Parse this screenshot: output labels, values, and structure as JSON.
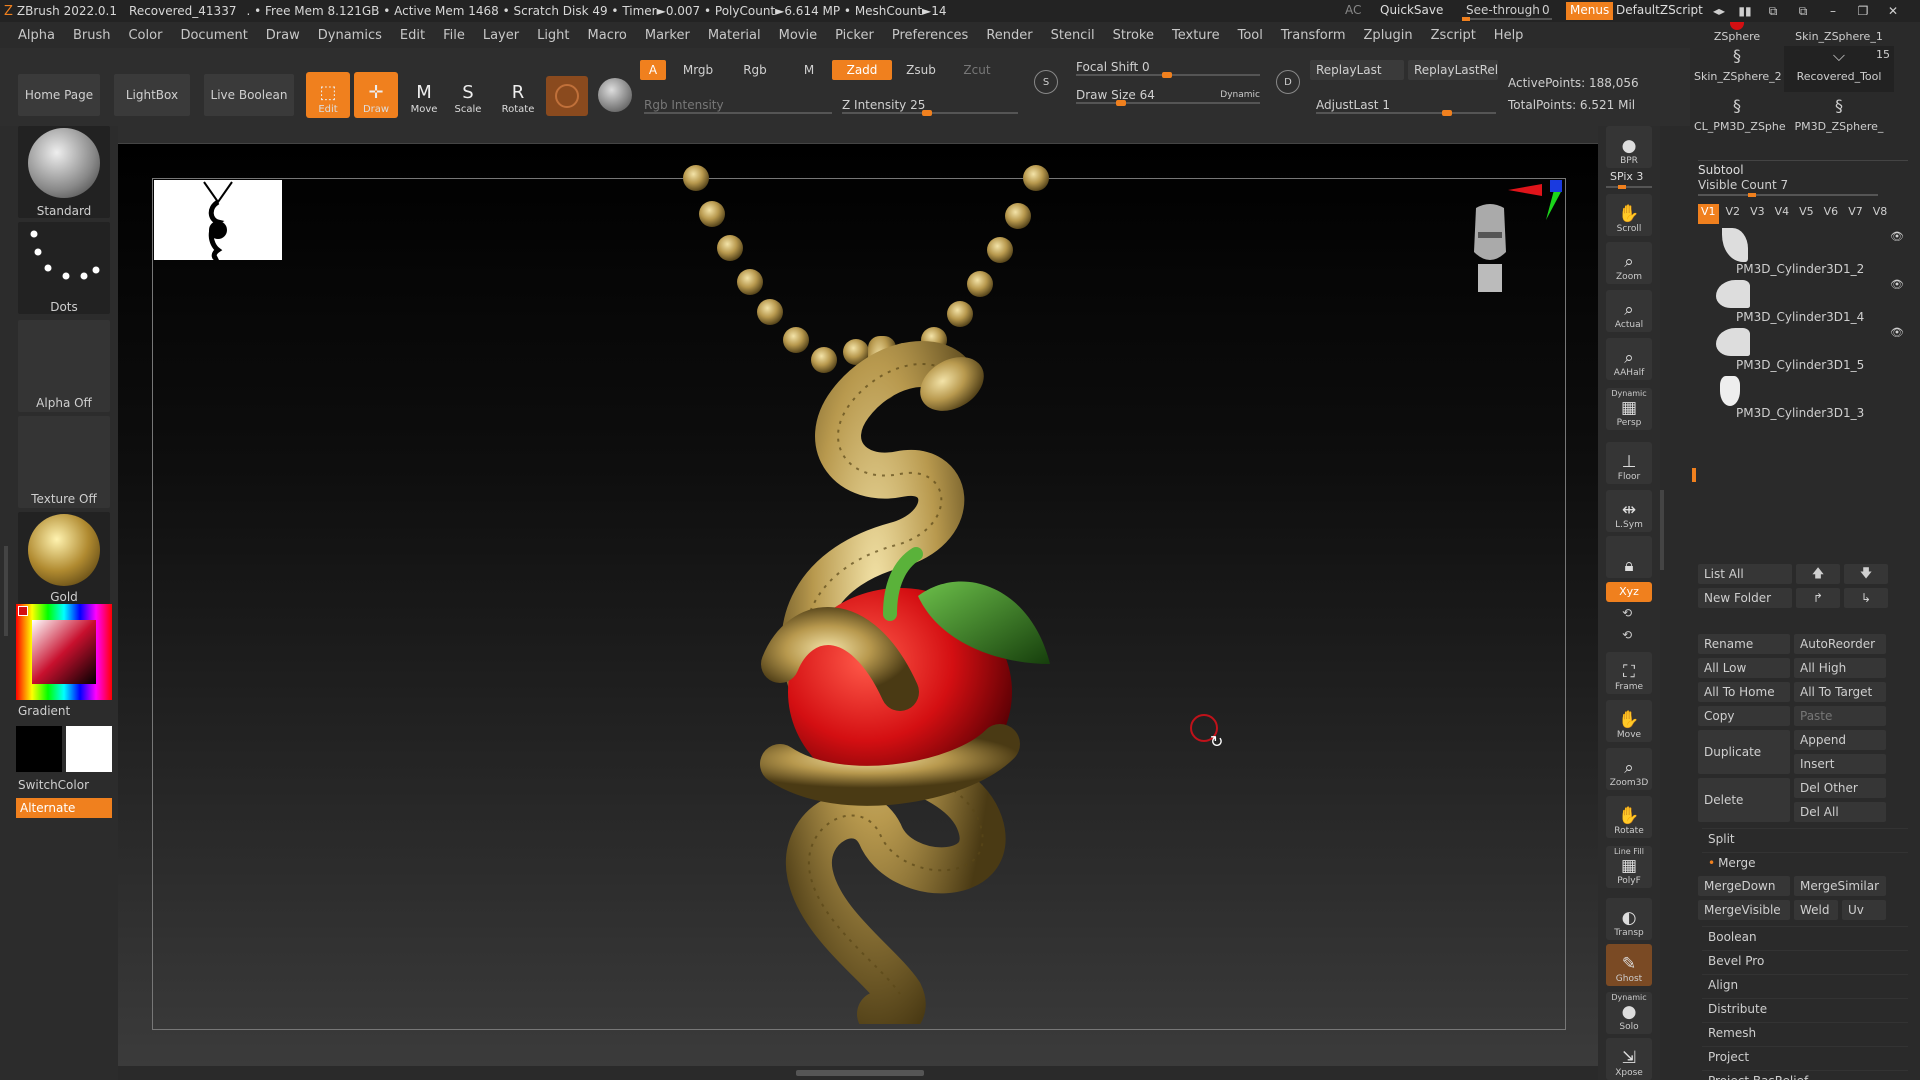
{
  "titlebar": {
    "app": "ZBrush 2022.0.1",
    "file": "Recovered_41337",
    "stats": ". • Free Mem 8.121GB • Active Mem 1468 • Scratch Disk 49 • Timer►0.007 • PolyCount►6.614 MP • MeshCount►14",
    "ac": "AC",
    "quicksave": "QuickSave",
    "seethrough_label": "See-through",
    "seethrough_value": "0",
    "menus": "Menus",
    "zscript": "DefaultZScript"
  },
  "menubar": [
    "Alpha",
    "Brush",
    "Color",
    "Document",
    "Draw",
    "Dynamics",
    "Edit",
    "File",
    "Layer",
    "Light",
    "Macro",
    "Marker",
    "Material",
    "Movie",
    "Picker",
    "Preferences",
    "Render",
    "Stencil",
    "Stroke",
    "Texture",
    "Tool",
    "Transform",
    "Zplugin",
    "Zscript",
    "Help"
  ],
  "toolbar": {
    "home": "Home Page",
    "lightbox": "LightBox",
    "liveboolean": "Live Boolean",
    "edit": "Edit",
    "draw": "Draw",
    "move": "Move",
    "scale": "Scale",
    "rotate": "Rotate",
    "a": "A",
    "mrgb": "Mrgb",
    "rgb": "Rgb",
    "m": "M",
    "zadd": "Zadd",
    "zsub": "Zsub",
    "zcut": "Zcut",
    "rgb_intensity": "Rgb Intensity",
    "z_intensity": "Z Intensity 25",
    "z_intensity_value": 25,
    "focal_shift": "Focal Shift 0",
    "draw_size": "Draw Size 64",
    "dynamic": "Dynamic",
    "replaylast": "ReplayLast",
    "replaylastrel": "ReplayLastRel",
    "adjustlast": "AdjustLast 1",
    "activepoints": "ActivePoints: 188,056",
    "totalpoints": "TotalPoints: 6.521 Mil"
  },
  "leftpanel": {
    "brush": "Standard",
    "stroke": "Dots",
    "alpha": "Alpha Off",
    "texture": "Texture Off",
    "material": "Gold",
    "gradient": "Gradient",
    "switchcolor": "SwitchColor",
    "alternate": "Alternate"
  },
  "rightshelf": [
    "BPR",
    "SPix 3",
    "Scroll",
    "Zoom",
    "Actual",
    "AAHalf",
    "Persp",
    "Floor",
    "L.Sym",
    "Xyz",
    "Frame",
    "Move",
    "Zoom3D",
    "Rotate",
    "PolyF",
    "Transp",
    "Ghost",
    "Solo",
    "Xpose"
  ],
  "rightshelf_extra": {
    "dynamic": "Dynamic",
    "linefill": "Line Fill"
  },
  "tray": {
    "tools": [
      {
        "name": "ZSphere"
      },
      {
        "name": "Skin_ZSphere_1"
      },
      {
        "name": "Skin_ZSphere_2"
      },
      {
        "name": "Recovered_Tool"
      },
      {
        "name": "CL_PM3D_ZSphe"
      },
      {
        "name": "PM3D_ZSphere_"
      }
    ],
    "tool_count": "15",
    "subtool_title": "Subtool",
    "visible_count": "Visible Count 7",
    "versions": [
      "V1",
      "V2",
      "V3",
      "V4",
      "V5",
      "V6",
      "V7",
      "V8"
    ],
    "subtools": [
      "PM3D_Cylinder3D1_2",
      "PM3D_Cylinder3D1_4",
      "PM3D_Cylinder3D1_5",
      "PM3D_Cylinder3D1_3"
    ],
    "listall": "List All",
    "newfolder": "New Folder",
    "rename": "Rename",
    "autoreorder": "AutoReorder",
    "alllow": "All Low",
    "allhigh": "All High",
    "alltohome": "All To Home",
    "alltotarget": "All To Target",
    "copy": "Copy",
    "paste": "Paste",
    "duplicate": "Duplicate",
    "append": "Append",
    "insert": "Insert",
    "delete": "Delete",
    "delother": "Del Other",
    "delall": "Del All",
    "split": "Split",
    "merge": "Merge",
    "mergedown": "MergeDown",
    "mergesimilar": "MergeSimilar",
    "mergevisible": "MergeVisible",
    "weld": "Weld",
    "uv": "Uv",
    "boolean": "Boolean",
    "bevelpro": "Bevel Pro",
    "align": "Align",
    "distribute": "Distribute",
    "remesh": "Remesh",
    "project": "Project",
    "projectbasrelief": "Project BasRelief"
  },
  "colors": {
    "accent": "#f0801e",
    "gold": "#c8ad6a",
    "apple": "#d40f12",
    "leaf": "#2e7a1e"
  }
}
